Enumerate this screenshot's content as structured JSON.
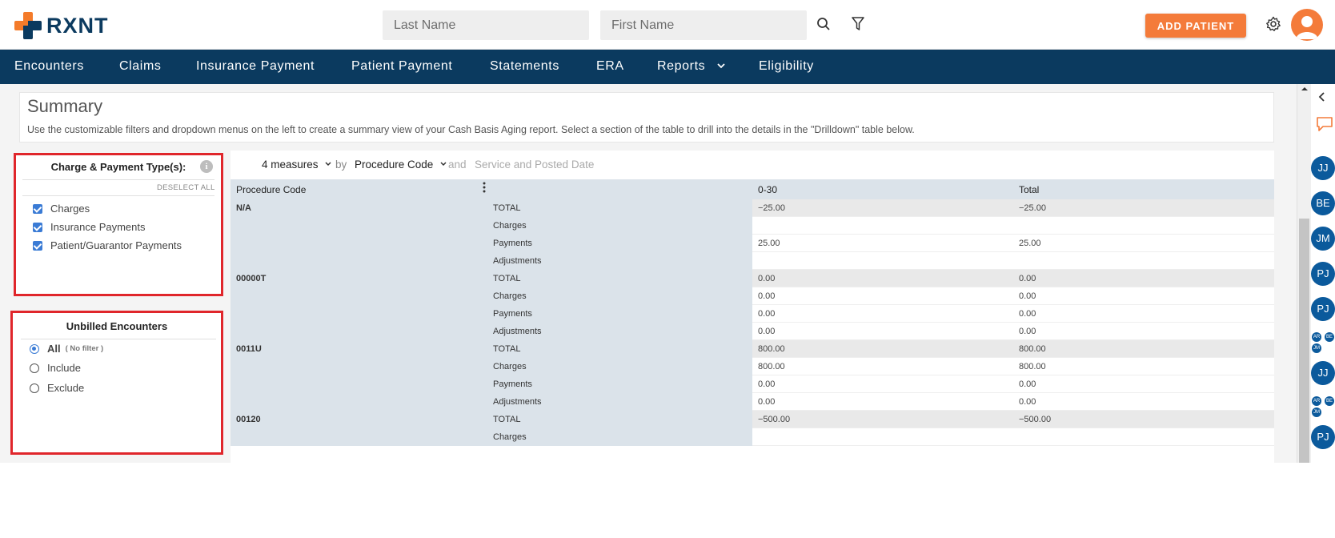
{
  "header": {
    "logo_text": "RXNT",
    "last_name_placeholder": "Last Name",
    "first_name_placeholder": "First Name",
    "add_patient_label": "ADD PATIENT"
  },
  "nav": {
    "items": [
      "Encounters",
      "Claims",
      "Insurance Payment",
      "Patient Payment",
      "Statements",
      "ERA",
      "Reports",
      "Eligibility"
    ]
  },
  "summary": {
    "title": "Summary",
    "description": "Use the customizable filters and dropdown menus on the left to create a summary view of your Cash Basis Aging report. Select a section of the table to drill into the details in the \"Drilldown\" table below."
  },
  "charge_panel": {
    "title": "Charge & Payment Type(s):",
    "info": "i",
    "deselect_all": "DESELECT ALL",
    "options": [
      "Charges",
      "Insurance Payments",
      "Patient/Guarantor Payments"
    ]
  },
  "unbilled_panel": {
    "title": "Unbilled Encounters",
    "options": [
      {
        "label": "All",
        "note": "( No filter )",
        "selected": true
      },
      {
        "label": "Include",
        "note": "",
        "selected": false
      },
      {
        "label": "Exclude",
        "note": "",
        "selected": false
      }
    ]
  },
  "pivot_bar": {
    "measures": "4 measures",
    "by": "by",
    "dimension": "Procedure Code",
    "and": "and",
    "secondary": "Service and Posted Date"
  },
  "pivot": {
    "headers": {
      "code": "Procedure Code",
      "col1": "0-30",
      "col2": "Total"
    },
    "rows": [
      {
        "code": "N/A",
        "type": "TOTAL",
        "c1": "−25.00",
        "c2": "−25.00"
      },
      {
        "code": "",
        "type": "Charges",
        "c1": "",
        "c2": ""
      },
      {
        "code": "",
        "type": "Payments",
        "c1": "25.00",
        "c2": "25.00"
      },
      {
        "code": "",
        "type": "Adjustments",
        "c1": "",
        "c2": ""
      },
      {
        "code": "00000T",
        "type": "TOTAL",
        "c1": "0.00",
        "c2": "0.00"
      },
      {
        "code": "",
        "type": "Charges",
        "c1": "0.00",
        "c2": "0.00"
      },
      {
        "code": "",
        "type": "Payments",
        "c1": "0.00",
        "c2": "0.00"
      },
      {
        "code": "",
        "type": "Adjustments",
        "c1": "0.00",
        "c2": "0.00"
      },
      {
        "code": "0011U",
        "type": "TOTAL",
        "c1": "800.00",
        "c2": "800.00"
      },
      {
        "code": "",
        "type": "Charges",
        "c1": "800.00",
        "c2": "800.00"
      },
      {
        "code": "",
        "type": "Payments",
        "c1": "0.00",
        "c2": "0.00"
      },
      {
        "code": "",
        "type": "Adjustments",
        "c1": "0.00",
        "c2": "0.00"
      },
      {
        "code": "00120",
        "type": "TOTAL",
        "c1": "−500.00",
        "c2": "−500.00"
      },
      {
        "code": "",
        "type": "Charges",
        "c1": "",
        "c2": ""
      }
    ]
  },
  "rail": {
    "avatars": [
      "JJ",
      "BE",
      "JM",
      "PJ",
      "PJ",
      "JJ",
      "PJ"
    ],
    "mini_groups": [
      [
        "AR",
        "BE",
        "JM"
      ],
      [
        "AR",
        "BE",
        "JM"
      ]
    ]
  },
  "colors": {
    "brand_navy": "#0b3a5f",
    "brand_orange": "#f47b3a",
    "highlight_red": "#e0262b",
    "checkbox_blue": "#3a7bd5"
  }
}
